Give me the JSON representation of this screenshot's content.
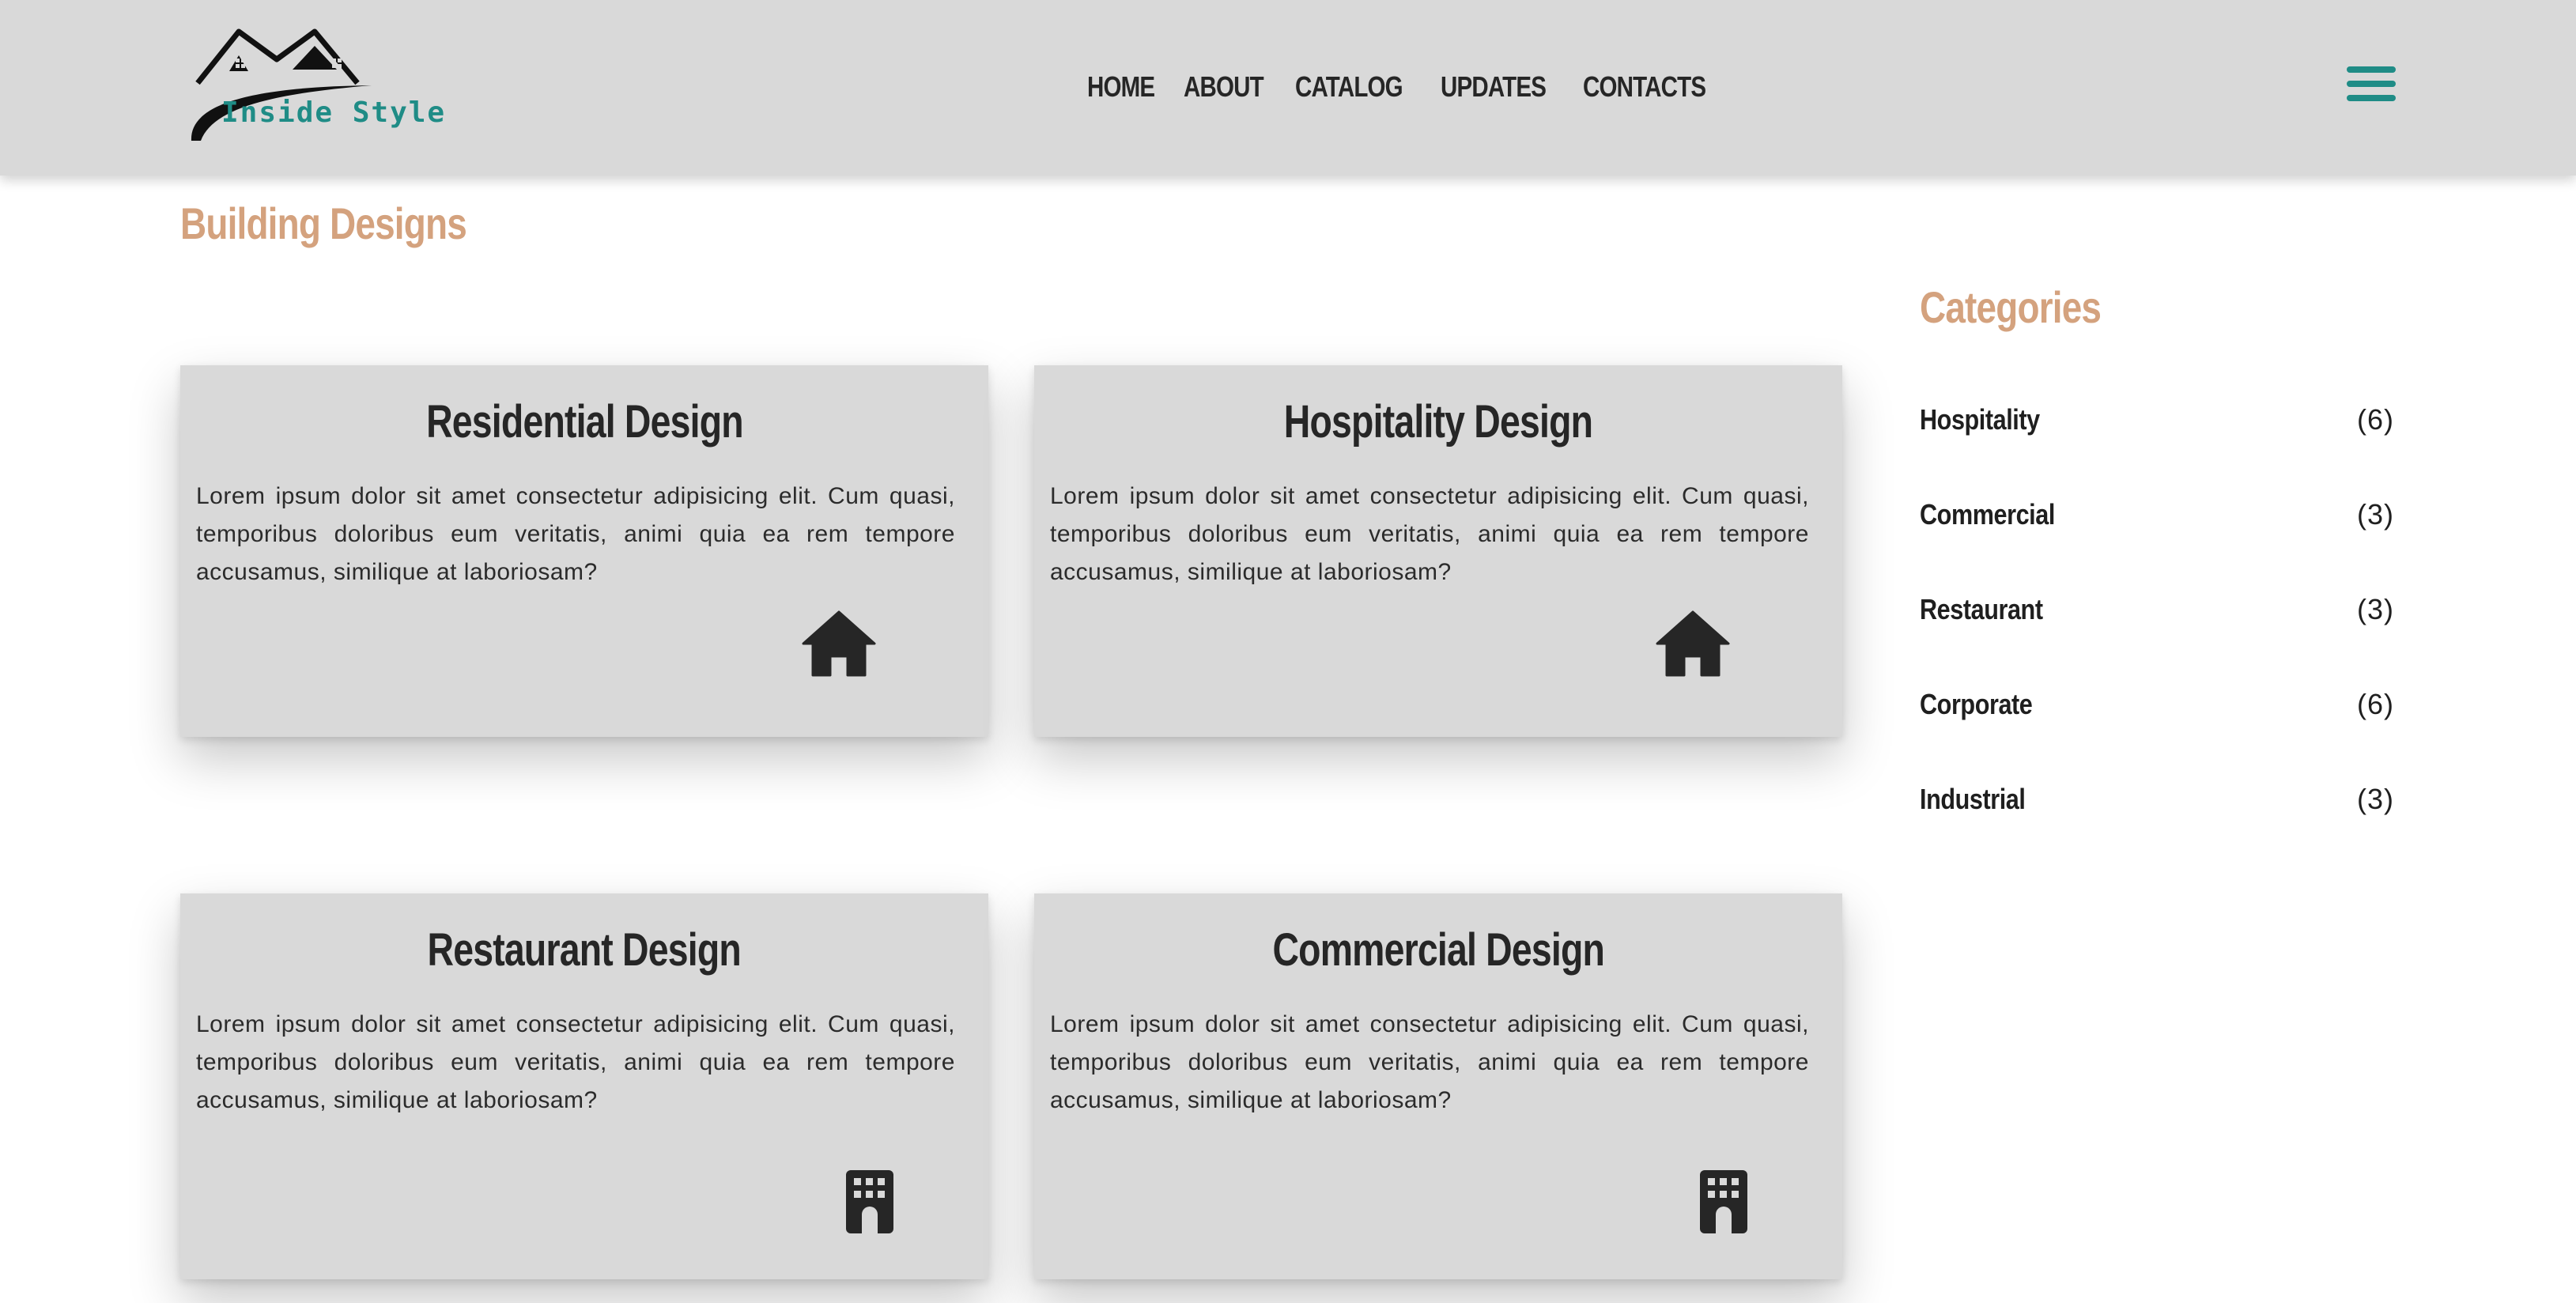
{
  "brand": {
    "name": "Inside Style",
    "accent": "#1f8c86"
  },
  "nav": {
    "items": [
      "HOME",
      "ABOUT",
      "CATALOG",
      "UPDATES",
      "CONTACTS"
    ]
  },
  "page": {
    "title": "Building Designs",
    "title_color": "#d4a27e"
  },
  "cards": [
    {
      "title": "Residential Design",
      "text": "Lorem ipsum dolor sit amet consectetur adipisicing elit. Cum quasi, temporibus doloribus eum veritatis, animi quia ea rem tempore accusamus, similique at laboriosam?",
      "icon": "house-icon"
    },
    {
      "title": "Hospitality Design",
      "text": "Lorem ipsum dolor sit amet consectetur adipisicing elit. Cum quasi, temporibus doloribus eum veritatis, animi quia ea rem tempore accusamus, similique at laboriosam?",
      "icon": "house-icon"
    },
    {
      "title": "Restaurant Design",
      "text": "Lorem ipsum dolor sit amet consectetur adipisicing elit. Cum quasi, temporibus doloribus eum veritatis, animi quia ea rem tempore accusamus, similique at laboriosam?",
      "icon": "building-icon"
    },
    {
      "title": "Commercial Design",
      "text": "Lorem ipsum dolor sit amet consectetur adipisicing elit. Cum quasi, temporibus doloribus eum veritatis, animi quia ea rem tempore accusamus, similique at laboriosam?",
      "icon": "building-icon"
    }
  ],
  "sidebar": {
    "title": "Categories",
    "categories": [
      {
        "name": "Hospitality",
        "count": "(6)"
      },
      {
        "name": "Commercial",
        "count": "(3)"
      },
      {
        "name": "Restaurant",
        "count": "(3)"
      },
      {
        "name": "Corporate",
        "count": "(6)"
      },
      {
        "name": "Industrial",
        "count": "(3)"
      }
    ]
  }
}
